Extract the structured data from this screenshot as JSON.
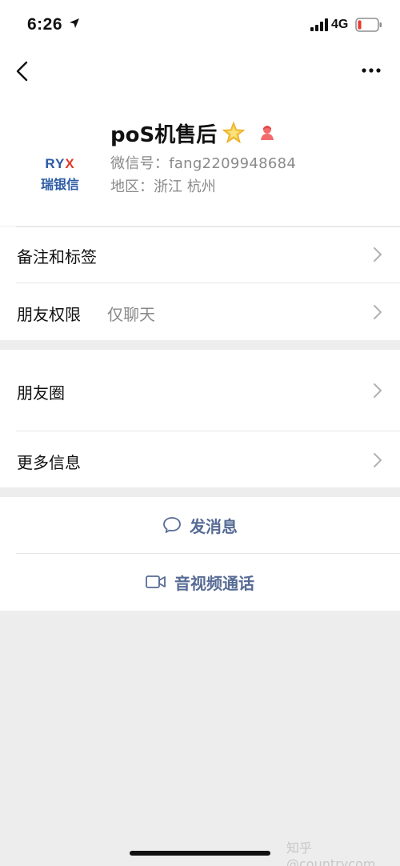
{
  "status_bar": {
    "time": "6:26",
    "network": "4G"
  },
  "nav": {
    "back_icon": "chevron-left-icon",
    "more_icon": "ellipsis-icon"
  },
  "profile": {
    "avatar_logo_pre": "RY",
    "avatar_logo_x": "X",
    "avatar_subtitle": "瑞银信",
    "nickname": "poS机售后",
    "wechat_id": "微信号：fang2209948684",
    "region": "地区：浙江 杭州",
    "star_icon": "star-emoji-icon",
    "gender_icon": "female-gender-icon",
    "colors": {
      "gender": "#f26c6c",
      "star": "#f5c540",
      "logo_blue": "#2b5aa5",
      "logo_red": "#e23c2c"
    }
  },
  "settings": {
    "remark_tags": "备注和标签",
    "friend_permission": "朋友权限",
    "friend_permission_value": "仅聊天",
    "moments": "朋友圈",
    "more_info": "更多信息"
  },
  "actions": {
    "send_message": "发消息",
    "video_call": "音视频通话",
    "link_color": "#576b95"
  },
  "watermark": "知乎 @countrycom"
}
